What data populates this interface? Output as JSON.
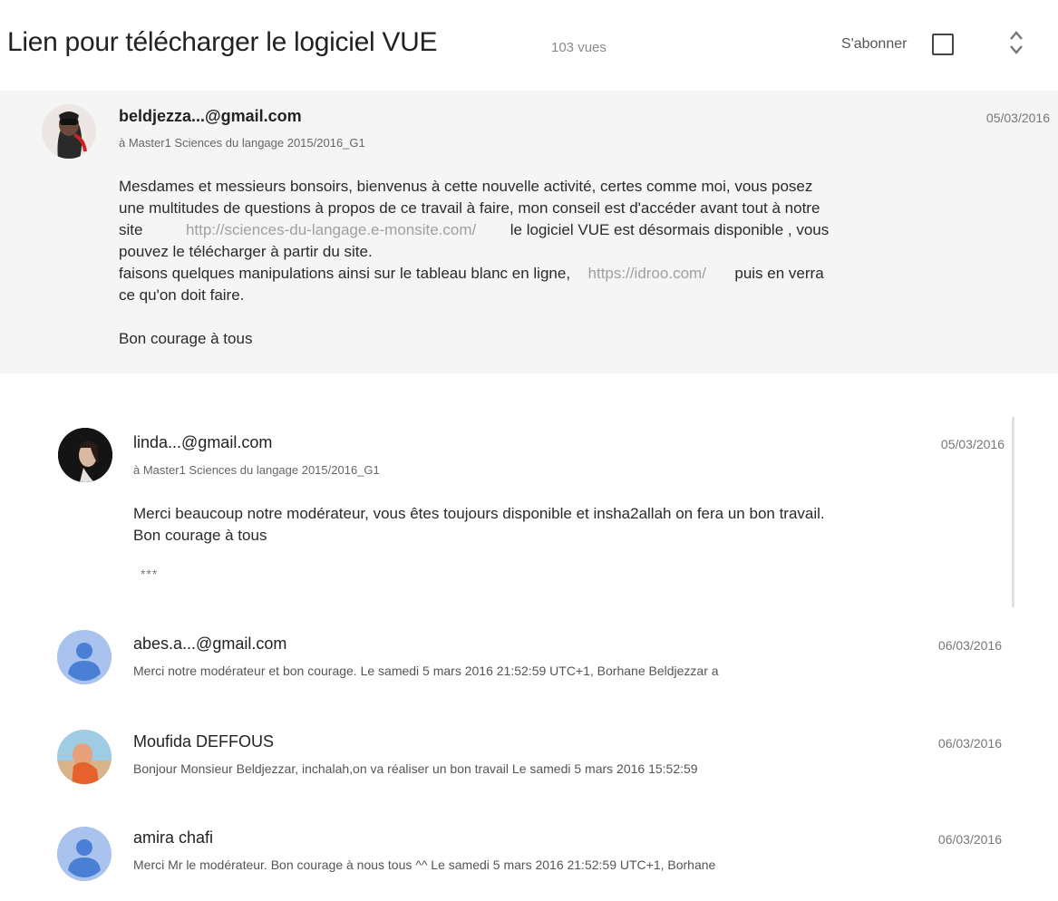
{
  "header": {
    "title": "Lien pour télécharger le logiciel VUE",
    "views": "103 vues",
    "subscribe_label": "S'abonner"
  },
  "main_post": {
    "author": "beldjezza...@gmail.com",
    "recipient": "à Master1 Sciences du langage 2015/2016_G1",
    "date": "05/03/2016",
    "body": {
      "line1": "Mesdames et messieurs bonsoirs,  bienvenus à cette nouvelle activité, certes comme moi, vous posez",
      "line2": "une multitudes de questions à propos de ce travail à faire, mon conseil est d'accéder avant tout à notre",
      "line3_prefix": "site",
      "line3_link": "http://sciences-du-langage.e-monsite.com/",
      "line3_suffix": "le logiciel VUE est désormais disponible , vous",
      "line4": "pouvez le télécharger à partir du site.",
      "line5_prefix": "faisons quelques manipulations ainsi sur le tableau blanc en ligne,",
      "line5_link": "https://idroo.com/",
      "line5_suffix": "puis en verra",
      "line6": "ce qu'on doit faire.",
      "closing": "Bon courage à tous"
    }
  },
  "reply": {
    "author": "linda...@gmail.com",
    "recipient": "à Master1 Sciences du langage 2015/2016_G1",
    "date": "05/03/2016",
    "line1": "Merci beaucoup notre modérateur, vous êtes toujours disponible et insha2allah on fera un bon travail.",
    "line2": "Bon courage à tous",
    "quoted_toggle": "***"
  },
  "collapsed_replies": [
    {
      "author": "abes.a...@gmail.com",
      "date": "06/03/2016",
      "snippet": "Merci notre modérateur et bon courage. Le samedi 5 mars 2016 21:52:59 UTC+1, Borhane Beldjezzar a"
    },
    {
      "author": "Moufida DEFFOUS",
      "date": "06/03/2016",
      "snippet": "Bonjour Monsieur Beldjezzar, inchalah,on va réaliser un bon travail Le samedi 5 mars 2016 15:52:59"
    },
    {
      "author": "amira chafi",
      "date": "06/03/2016",
      "snippet": "Merci Mr le modérateur. Bon courage à nous tous ^^ Le samedi 5 mars 2016 21:52:59 UTC+1, Borhane"
    }
  ],
  "colors": {
    "main_post_bg": "#f5f5f5",
    "default_avatar": "#a9c2ee",
    "link": "#a0a0a0"
  }
}
